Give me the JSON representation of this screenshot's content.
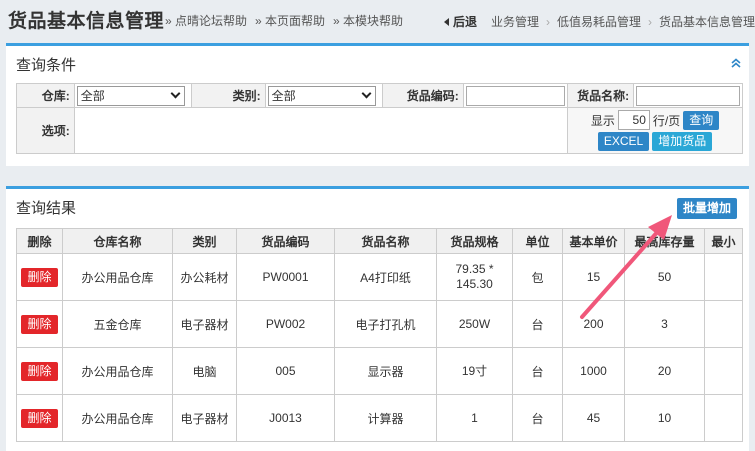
{
  "header": {
    "title": "货品基本信息管理",
    "help_links": [
      "» 点晴论坛帮助",
      "» 本页面帮助",
      "» 本模块帮助"
    ],
    "back_label": "后退",
    "breadcrumbs": [
      "业务管理",
      "低值易耗品管理",
      "货品基本信息管理"
    ]
  },
  "conditions": {
    "title": "查询条件",
    "warehouse_label": "仓库:",
    "warehouse_value": "全部",
    "category_label": "类别:",
    "category_value": "全部",
    "code_label": "货品编码:",
    "name_label": "货品名称:",
    "options_label": "选项:",
    "show_label": "显示",
    "page_size": "50",
    "per_page_label": "行/页",
    "query_button": "查询",
    "excel_button": "EXCEL",
    "add_button": "增加货品"
  },
  "results": {
    "title": "查询结果",
    "bulk_add_button": "批量增加",
    "columns": [
      "删除",
      "仓库名称",
      "类别",
      "货品编码",
      "货品名称",
      "货品规格",
      "单位",
      "基本单价",
      "最高库存量",
      "最小"
    ],
    "delete_label": "删除",
    "rows": [
      {
        "warehouse": "办公用品仓库",
        "category": "办公耗材",
        "code": "PW0001",
        "name": "A4打印纸",
        "spec_line1": "79.35 *",
        "spec_line2": "145.30",
        "unit": "包",
        "price": "15",
        "max_stock": "50",
        "min_stock": ""
      },
      {
        "warehouse": "五金仓库",
        "category": "电子器材",
        "code": "PW002",
        "name": "电子打孔机",
        "spec_line1": "250W",
        "spec_line2": "",
        "unit": "台",
        "price": "200",
        "max_stock": "3",
        "min_stock": ""
      },
      {
        "warehouse": "办公用品仓库",
        "category": "电脑",
        "code": "005",
        "name": "显示器",
        "spec_line1": "19寸",
        "spec_line2": "",
        "unit": "台",
        "price": "1000",
        "max_stock": "20",
        "min_stock": ""
      },
      {
        "warehouse": "办公用品仓库",
        "category": "电子器材",
        "code": "J0013",
        "name": "计算器",
        "spec_line1": "1",
        "spec_line2": "",
        "unit": "台",
        "price": "45",
        "max_stock": "10",
        "min_stock": ""
      }
    ]
  },
  "colors": {
    "accent": "#3b9fe0",
    "button_blue": "#2e86c7",
    "delete_red": "#e3262a",
    "annotation_arrow": "#f0577a"
  }
}
